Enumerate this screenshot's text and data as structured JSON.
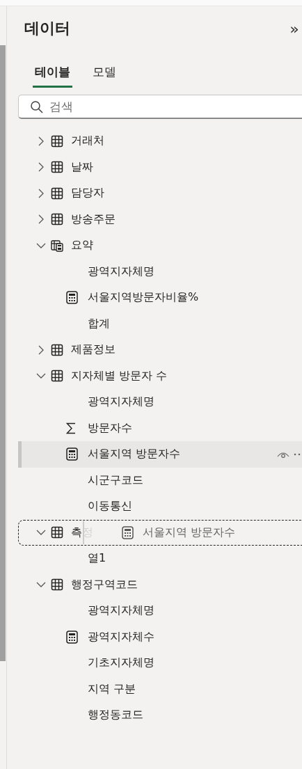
{
  "panel": {
    "title": "데이터",
    "collapse_icon": "»"
  },
  "tabs": [
    {
      "label": "테이블",
      "selected": true
    },
    {
      "label": "모델",
      "selected": false
    }
  ],
  "search": {
    "placeholder": "검색"
  },
  "tree": [
    {
      "kind": "table",
      "label": "거래처",
      "expanded": false,
      "drop_target": false
    },
    {
      "kind": "table",
      "label": "날짜",
      "expanded": false,
      "drop_target": false
    },
    {
      "kind": "table",
      "label": "담당자",
      "expanded": false,
      "drop_target": false
    },
    {
      "kind": "table",
      "label": "방송주문",
      "expanded": false,
      "drop_target": false
    },
    {
      "kind": "measure-table",
      "label": "요약",
      "expanded": true,
      "drop_target": false,
      "children": [
        {
          "kind": "column",
          "label": "광역지자체명",
          "selected": false
        },
        {
          "kind": "measure",
          "label": "서울지역방문자비율%",
          "selected": false
        },
        {
          "kind": "column",
          "label": "합계",
          "selected": false
        }
      ]
    },
    {
      "kind": "table",
      "label": "제품정보",
      "expanded": false,
      "drop_target": false
    },
    {
      "kind": "table",
      "label": "지자체별 방문자 수",
      "expanded": true,
      "drop_target": false,
      "children": [
        {
          "kind": "column",
          "label": "광역지자체명",
          "selected": false
        },
        {
          "kind": "sum",
          "label": "방문자수",
          "selected": false
        },
        {
          "kind": "measure",
          "label": "서울지역 방문자수",
          "selected": true
        },
        {
          "kind": "column",
          "label": "시군구코드",
          "selected": false
        },
        {
          "kind": "column",
          "label": "이동통신",
          "selected": false
        }
      ]
    },
    {
      "kind": "table",
      "label": "측정",
      "expanded": true,
      "drop_target": true,
      "drag_ghost": {
        "kind": "measure",
        "label": "서울지역 방문자수"
      },
      "children": [
        {
          "kind": "column",
          "label": "열1",
          "selected": false
        }
      ]
    },
    {
      "kind": "table",
      "label": "행정구역코드",
      "expanded": true,
      "drop_target": false,
      "children": [
        {
          "kind": "column",
          "label": "광역지자체명",
          "selected": false
        },
        {
          "kind": "measure",
          "label": "광역지자체수",
          "selected": false
        },
        {
          "kind": "column",
          "label": "기초지자체명",
          "selected": false
        },
        {
          "kind": "column",
          "label": "지역 구분",
          "selected": false
        },
        {
          "kind": "column",
          "label": "행정동코드",
          "selected": false
        }
      ]
    }
  ]
}
